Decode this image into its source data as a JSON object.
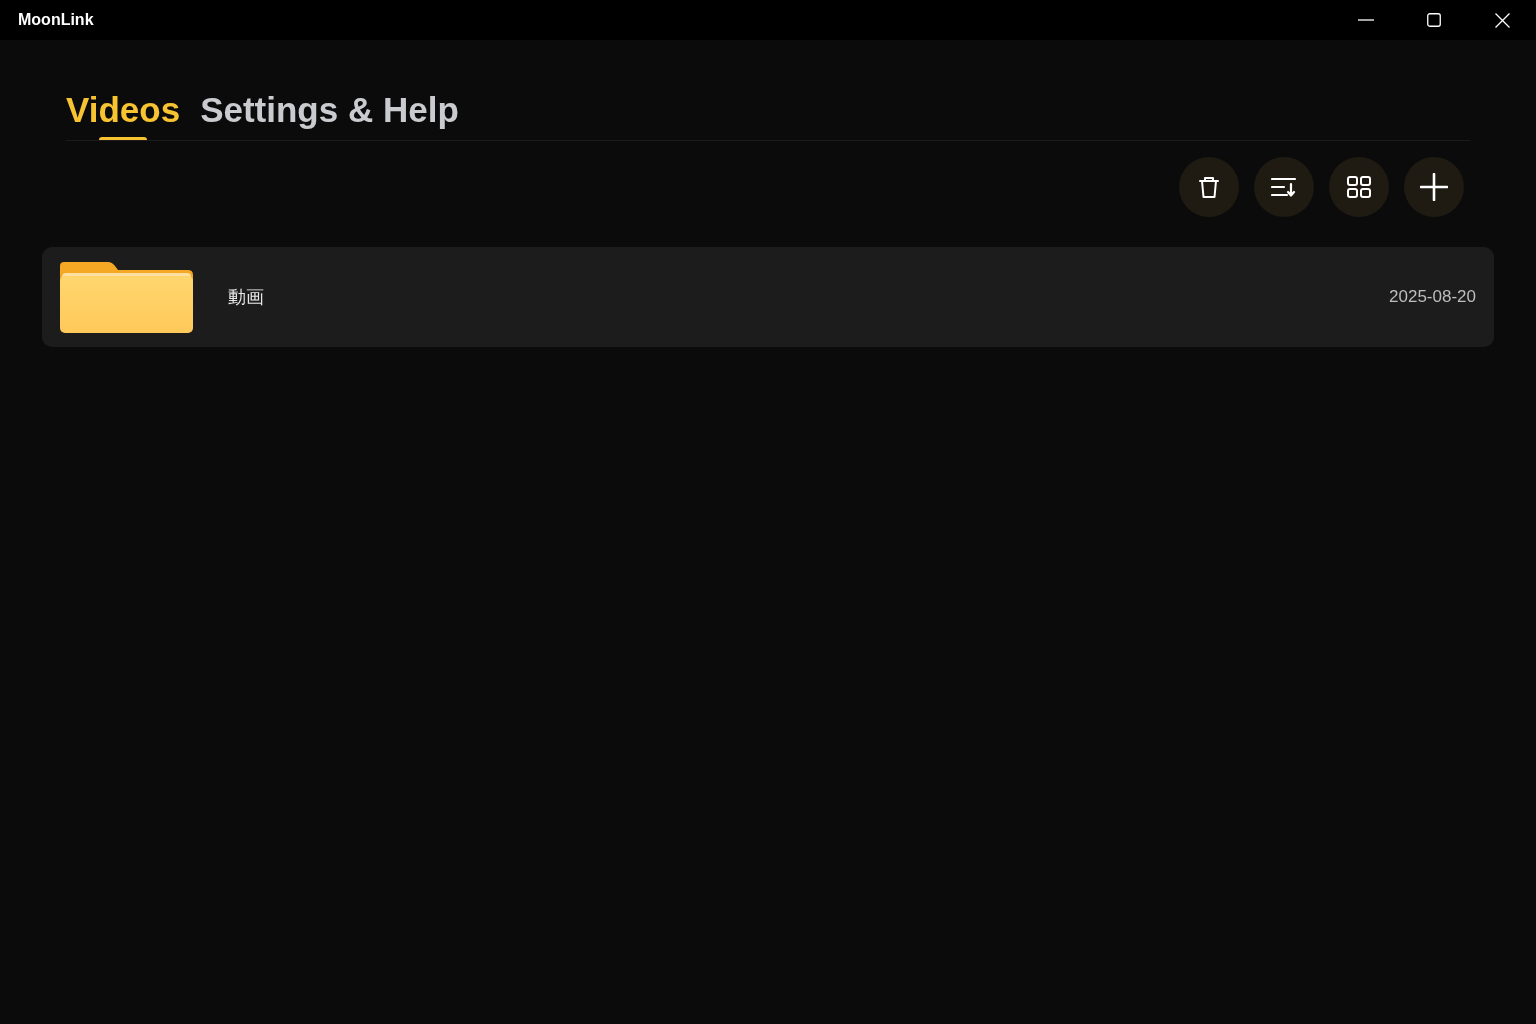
{
  "window": {
    "title": "MoonLink"
  },
  "tabs": [
    {
      "label": "Videos",
      "selected": true
    },
    {
      "label": "Settings & Help",
      "selected": false
    }
  ],
  "folders": [
    {
      "name": "動画",
      "date": "2025-08-20"
    }
  ]
}
